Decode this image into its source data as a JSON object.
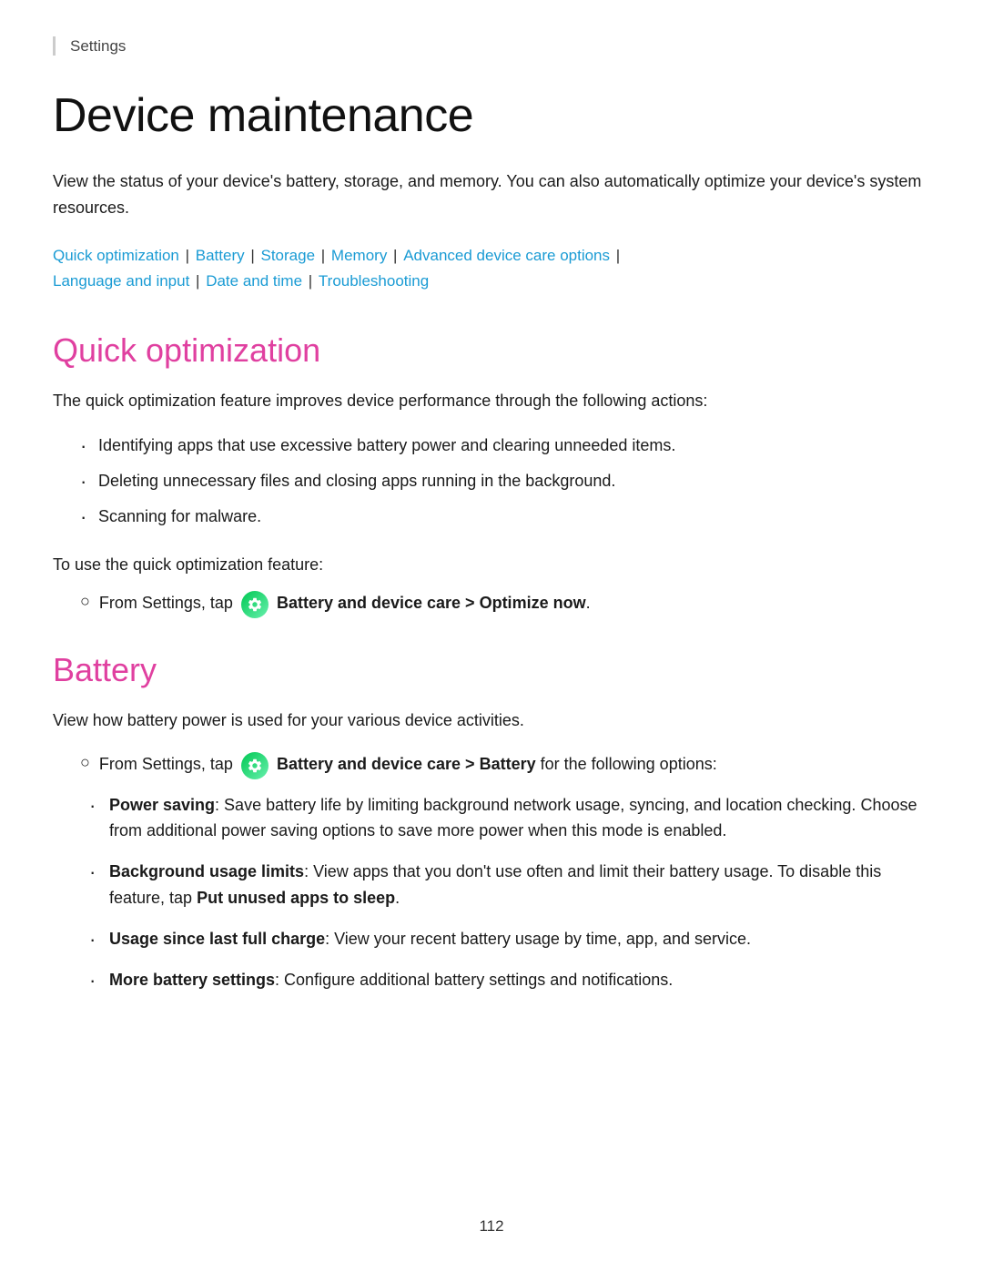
{
  "breadcrumb": {
    "label": "Settings"
  },
  "page": {
    "title": "Device maintenance",
    "intro": "View the status of your device's battery, storage, and memory. You can also automatically optimize your device's system resources.",
    "nav_links": [
      {
        "label": "Quick optimization",
        "href": "#quick-optimization"
      },
      {
        "label": "Battery",
        "href": "#battery"
      },
      {
        "label": "Storage",
        "href": "#storage"
      },
      {
        "label": "Memory",
        "href": "#memory"
      },
      {
        "label": "Advanced device care options",
        "href": "#advanced"
      },
      {
        "label": "Language and input",
        "href": "#language"
      },
      {
        "label": "Date and time",
        "href": "#date"
      },
      {
        "label": "Troubleshooting",
        "href": "#troubleshooting"
      }
    ]
  },
  "sections": {
    "quick_optimization": {
      "heading": "Quick optimization",
      "intro": "The quick optimization feature improves device performance through the following actions:",
      "bullets": [
        "Identifying apps that use excessive battery power and clearing unneeded items.",
        "Deleting unnecessary files and closing apps running in the background.",
        "Scanning for malware."
      ],
      "instruction_prefix": "To use the quick optimization feature:",
      "step": {
        "prefix": "From Settings, tap",
        "bold_part": "Battery and device care > Optimize now",
        "suffix": "."
      }
    },
    "battery": {
      "heading": "Battery",
      "intro": "View how battery power is used for your various device activities.",
      "step": {
        "prefix": "From Settings, tap",
        "bold_part": "Battery and device care > Battery",
        "suffix": "for the following options:"
      },
      "sub_bullets": [
        {
          "bold": "Power saving",
          "text": ": Save battery life by limiting background network usage, syncing, and location checking. Choose from additional power saving options to save more power when this mode is enabled."
        },
        {
          "bold": "Background usage limits",
          "text": ": View apps that you don't use often and limit their battery usage. To disable this feature, tap",
          "bold2": "Put unused apps to sleep",
          "text2": "."
        },
        {
          "bold": "Usage since last full charge",
          "text": ": View your recent battery usage by time, app, and service."
        },
        {
          "bold": "More battery settings",
          "text": ": Configure additional battery settings and notifications."
        }
      ]
    }
  },
  "page_number": "112"
}
